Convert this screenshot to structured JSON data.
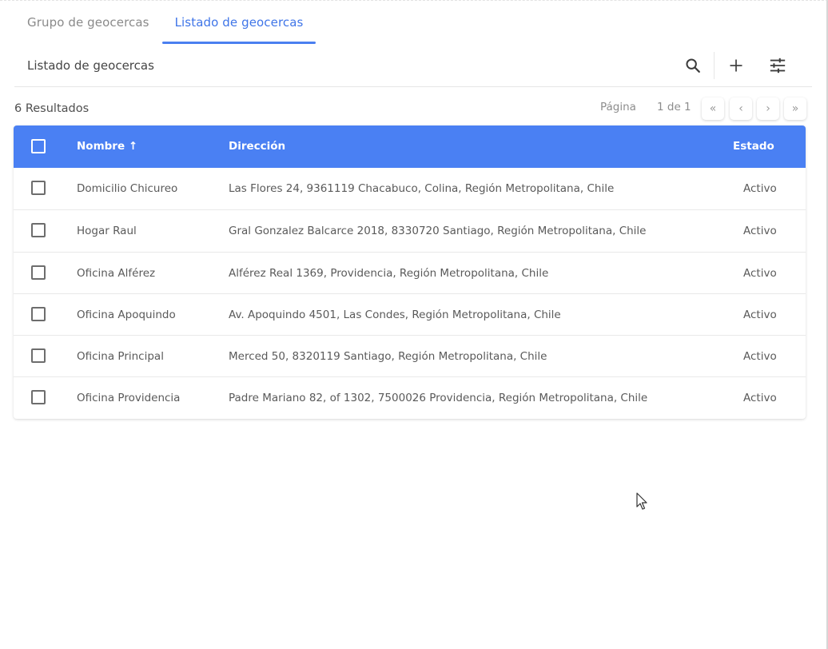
{
  "tabs": [
    {
      "label": "Grupo de geocercas",
      "active": false
    },
    {
      "label": "Listado de geocercas",
      "active": true
    }
  ],
  "toolbar": {
    "title": "Listado de geocercas",
    "icons": [
      "search-icon",
      "add-icon",
      "filter-settings-icon"
    ]
  },
  "results": {
    "count_label": "6 Resultados",
    "page_label": "Página",
    "page_count": "1 de 1",
    "pager_buttons": [
      "«",
      "‹",
      "›",
      "»"
    ]
  },
  "table": {
    "headers": {
      "name": "Nombre ↑",
      "address": "Dirección",
      "state": "Estado"
    },
    "rows": [
      {
        "name": "Domicilio Chicureo",
        "address": "Las Flores 24, 9361119 Chacabuco, Colina, Región Metropolitana, Chile",
        "state": "Activo"
      },
      {
        "name": "Hogar Raul",
        "address": "Gral Gonzalez Balcarce 2018, 8330720 Santiago, Región Metropolitana, Chile",
        "state": "Activo"
      },
      {
        "name": "Oficina Alférez",
        "address": "Alférez Real 1369, Providencia, Región Metropolitana, Chile",
        "state": "Activo"
      },
      {
        "name": "Oficina Apoquindo",
        "address": "Av. Apoquindo 4501, Las Condes, Región Metropolitana, Chile",
        "state": "Activo"
      },
      {
        "name": "Oficina Principal",
        "address": "Merced 50, 8320119 Santiago, Región Metropolitana, Chile",
        "state": "Activo"
      },
      {
        "name": "Oficina Providencia",
        "address": "Padre Mariano 82, of 1302, 7500026 Providencia, Región Metropolitana, Chile",
        "state": "Activo"
      }
    ]
  },
  "colors": {
    "accent": "#4a80f3",
    "active_tab": "#3f75e8"
  }
}
